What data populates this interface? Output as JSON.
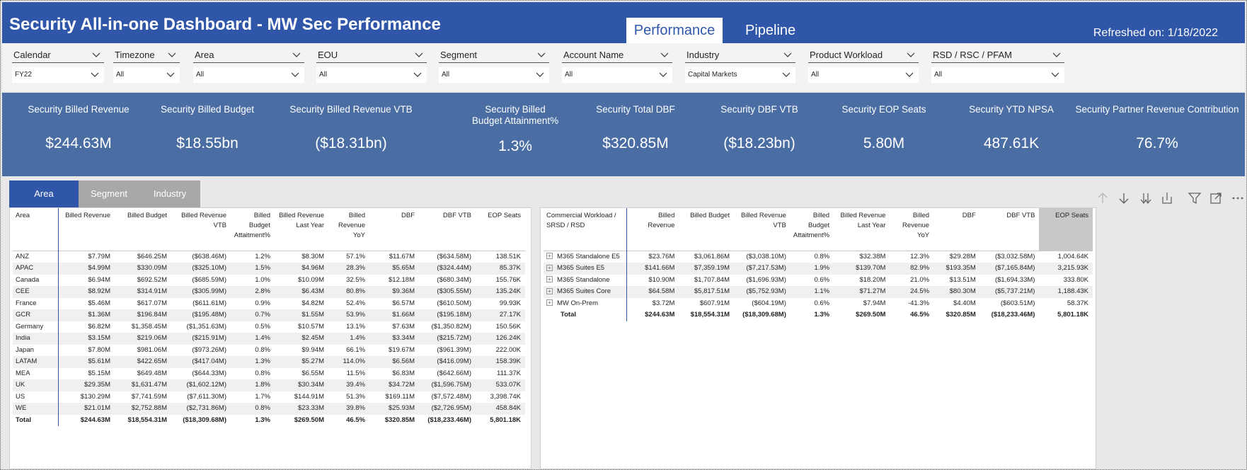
{
  "header": {
    "title": "Security All-in-one Dashboard - MW Sec Performance",
    "tabs": [
      "Performance",
      "Pipeline"
    ],
    "refresh": "Refreshed on: 1/18/2022",
    "bg_color": "#2f56a8"
  },
  "slicers": [
    {
      "label": "Calendar",
      "value": "FY22"
    },
    {
      "label": "Timezone",
      "value": "All"
    },
    {
      "label": "Area",
      "value": "All"
    },
    {
      "label": "EOU",
      "value": "All"
    },
    {
      "label": "Segment",
      "value": "All"
    },
    {
      "label": "Account Name",
      "value": "All"
    },
    {
      "label": "Industry",
      "value": "Capital Markets"
    },
    {
      "label": "Product Workload",
      "value": "All"
    },
    {
      "label": "RSD / RSC / PFAM",
      "value": "All"
    }
  ],
  "kpis": [
    {
      "label": "Security Billed Revenue",
      "value": "$244.63M"
    },
    {
      "label": "Security Billed Budget",
      "value": "$18.55bn"
    },
    {
      "label": "Security Billed Revenue VTB",
      "value": "($18.31bn)"
    },
    {
      "label": "Security Billed Budget Attainment%",
      "value": "1.3%"
    },
    {
      "label": "Security Total DBF",
      "value": "$320.85M"
    },
    {
      "label": "Security DBF VTB",
      "value": "($18.23bn)"
    },
    {
      "label": "Security EOP Seats",
      "value": "5.80M"
    },
    {
      "label": "Security YTD NPSA",
      "value": "487.61K"
    },
    {
      "label": "Security Partner Revenue Contribution",
      "value": "76.7%"
    }
  ],
  "view_tabs": [
    "Area",
    "Segment",
    "Industry"
  ],
  "area_table": {
    "headers": [
      "Area",
      "Billed Revenue",
      "Billed Budget",
      "Billed Revenue VTB",
      "Billed Budget Attaitment%",
      "Billed Revenue Last Year",
      "Billed Revenue YoY",
      "DBF",
      "DBF VTB",
      "EOP Seats"
    ],
    "rows": [
      [
        "ANZ",
        "$7.79M",
        "$646.25M",
        "($638.46M)",
        "1.2%",
        "$8.30M",
        "57.1%",
        "$11.67M",
        "($634.58M)",
        "138.51K"
      ],
      [
        "APAC",
        "$4.99M",
        "$330.09M",
        "($325.10M)",
        "1.5%",
        "$4.96M",
        "28.3%",
        "$5.65M",
        "($324.44M)",
        "85.37K"
      ],
      [
        "Canada",
        "$6.94M",
        "$692.52M",
        "($685.59M)",
        "1.0%",
        "$10.09M",
        "32.5%",
        "$12.18M",
        "($680.34M)",
        "155.76K"
      ],
      [
        "CEE",
        "$8.92M",
        "$314.91M",
        "($305.99M)",
        "2.8%",
        "$6.43M",
        "80.8%",
        "$9.36M",
        "($305.55M)",
        "135.24K"
      ],
      [
        "France",
        "$5.46M",
        "$617.07M",
        "($611.61M)",
        "0.9%",
        "$4.82M",
        "52.4%",
        "$6.57M",
        "($610.50M)",
        "99.93K"
      ],
      [
        "GCR",
        "$1.36M",
        "$196.84M",
        "($195.48M)",
        "0.7%",
        "$1.55M",
        "53.9%",
        "$1.66M",
        "($195.18M)",
        "27.17K"
      ],
      [
        "Germany",
        "$6.82M",
        "$1,358.45M",
        "($1,351.63M)",
        "0.5%",
        "$10.57M",
        "13.1%",
        "$7.63M",
        "($1,350.82M)",
        "150.56K"
      ],
      [
        "India",
        "$3.15M",
        "$219.06M",
        "($215.91M)",
        "1.4%",
        "$2.45M",
        "1.4%",
        "$3.34M",
        "($215.72M)",
        "126.24K"
      ],
      [
        "Japan",
        "$7.80M",
        "$981.06M",
        "($973.26M)",
        "0.8%",
        "$9.94M",
        "66.1%",
        "$19.67M",
        "($961.39M)",
        "222.00K"
      ],
      [
        "LATAM",
        "$5.61M",
        "$422.65M",
        "($417.04M)",
        "1.3%",
        "$5.27M",
        "114.0%",
        "$6.56M",
        "($416.09M)",
        "158.39K"
      ],
      [
        "MEA",
        "$5.15M",
        "$649.48M",
        "($644.33M)",
        "0.8%",
        "$6.55M",
        "11.5%",
        "$6.83M",
        "($642.66M)",
        "111.37K"
      ],
      [
        "UK",
        "$29.35M",
        "$1,631.47M",
        "($1,602.12M)",
        "1.8%",
        "$30.34M",
        "39.4%",
        "$34.72M",
        "($1,596.75M)",
        "533.07K"
      ],
      [
        "US",
        "$130.29M",
        "$7,741.59M",
        "($7,611.30M)",
        "1.7%",
        "$144.91M",
        "51.3%",
        "$169.11M",
        "($7,572.48M)",
        "3,398.74K"
      ],
      [
        "WE",
        "$21.01M",
        "$2,752.88M",
        "($2,731.86M)",
        "0.8%",
        "$23.33M",
        "39.8%",
        "$25.93M",
        "($2,726.95M)",
        "458.84K"
      ]
    ],
    "total": [
      "Total",
      "$244.63M",
      "$18,554.31M",
      "($18,309.68M)",
      "1.3%",
      "$269.50M",
      "46.5%",
      "$320.85M",
      "($18,233.46M)",
      "5,801.18K"
    ]
  },
  "workload_table": {
    "headers": [
      "Commercial Workload / SRSD / RSD",
      "Billed Revenue",
      "Billed Budget",
      "Billed Revenue VTB",
      "Billed Budget Attaitment%",
      "Billed Revenue Last Year",
      "Billed Revenue YoY",
      "DBF",
      "DBF VTB",
      "EOP Seats"
    ],
    "rows": [
      [
        "M365 Standalone E5",
        "$23.76M",
        "$3,061.86M",
        "($3,038.10M)",
        "0.8%",
        "$32.38M",
        "12.3%",
        "$29.28M",
        "($3,032.58M)",
        "1,004.64K"
      ],
      [
        "M365 Suites E5",
        "$141.66M",
        "$7,359.19M",
        "($7,217.53M)",
        "1.9%",
        "$139.70M",
        "82.9%",
        "$193.35M",
        "($7,165.84M)",
        "3,215.93K"
      ],
      [
        "M365 Standalone",
        "$10.90M",
        "$1,707.84M",
        "($1,696.93M)",
        "0.6%",
        "$18.20M",
        "21.0%",
        "$13.51M",
        "($1,694.33M)",
        "333.80K"
      ],
      [
        "M365 Suites Core",
        "$64.58M",
        "$5,817.51M",
        "($5,752.93M)",
        "1.1%",
        "$71.27M",
        "24.5%",
        "$80.30M",
        "($5,737.21M)",
        "1,188.43K"
      ],
      [
        "MW On-Prem",
        "$3.72M",
        "$607.91M",
        "($604.19M)",
        "0.6%",
        "$7.94M",
        "-41.3%",
        "$4.40M",
        "($603.51M)",
        "58.37K"
      ]
    ],
    "total": [
      "Total",
      "$244.63M",
      "$18,554.31M",
      "($18,309.68M)",
      "1.3%",
      "$269.50M",
      "46.5%",
      "$320.85M",
      "($18,233.46M)",
      "5,801.18K"
    ],
    "expand_symbol": "+"
  }
}
